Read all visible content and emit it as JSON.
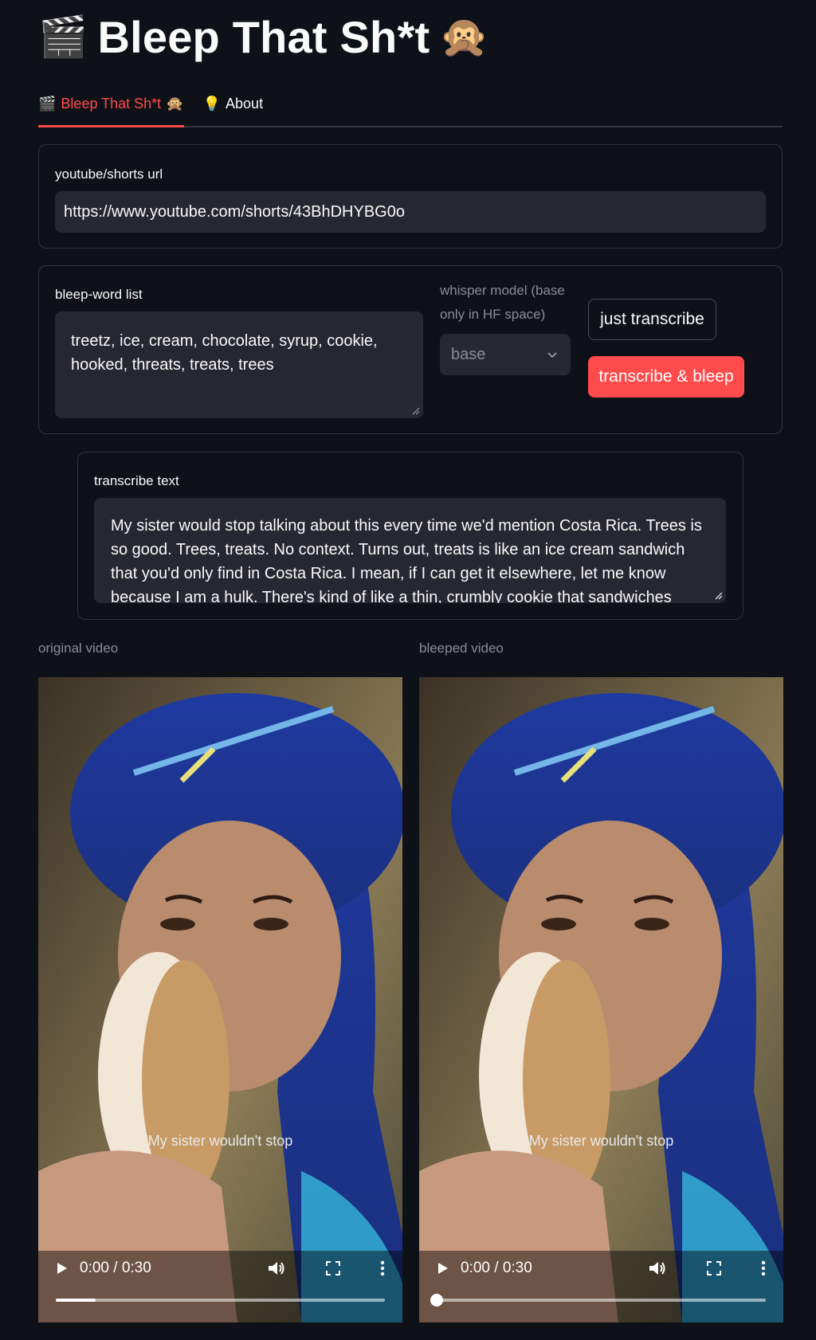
{
  "app": {
    "title": "Bleep That Sh*t",
    "title_left_icon": "clapper-board-icon",
    "title_right_icon": "see-no-evil-monkey-icon"
  },
  "tabs": [
    {
      "label": "Bleep That Sh*t",
      "icon": "clapper-board-icon",
      "active": true
    },
    {
      "label": "About",
      "icon": "lightbulb-icon",
      "active": false
    }
  ],
  "url_section": {
    "label": "youtube/shorts url",
    "value": "https://www.youtube.com/shorts/43BhDHYBG0o"
  },
  "bleep_section": {
    "word_list_label": "bleep-word list",
    "word_list_value": "treetz, ice, cream, chocolate, syrup, cookie, hooked, threats, treats, trees",
    "model_label": "whisper model (base only in HF space)",
    "model_selected": "base",
    "just_transcribe_label": "just transcribe",
    "transcribe_bleep_label": "transcribe & bleep"
  },
  "transcribe": {
    "label": "transcribe text",
    "text": "My sister would stop talking about this every time we'd mention Costa Rica. Trees is so good. Trees, treats. No context. Turns out, treats is like an ice cream sandwich that you'd only find in Costa Rica. I mean, if I can get it elsewhere, let me know because I am a hulk. There's kind of like a thin, crumbly cookie that sandwiches"
  },
  "videos": {
    "original": {
      "label": "original video",
      "caption": "My sister wouldn't stop",
      "time": "0:00 / 0:30",
      "progress": 0.12
    },
    "bleeped": {
      "label": "bleeped video",
      "caption": "My sister wouldn't stop",
      "time": "0:00 / 0:30",
      "progress": 0.0
    }
  },
  "colors": {
    "background": "#0e1117",
    "accent": "#ff4b4b",
    "input_bg": "#262730"
  }
}
